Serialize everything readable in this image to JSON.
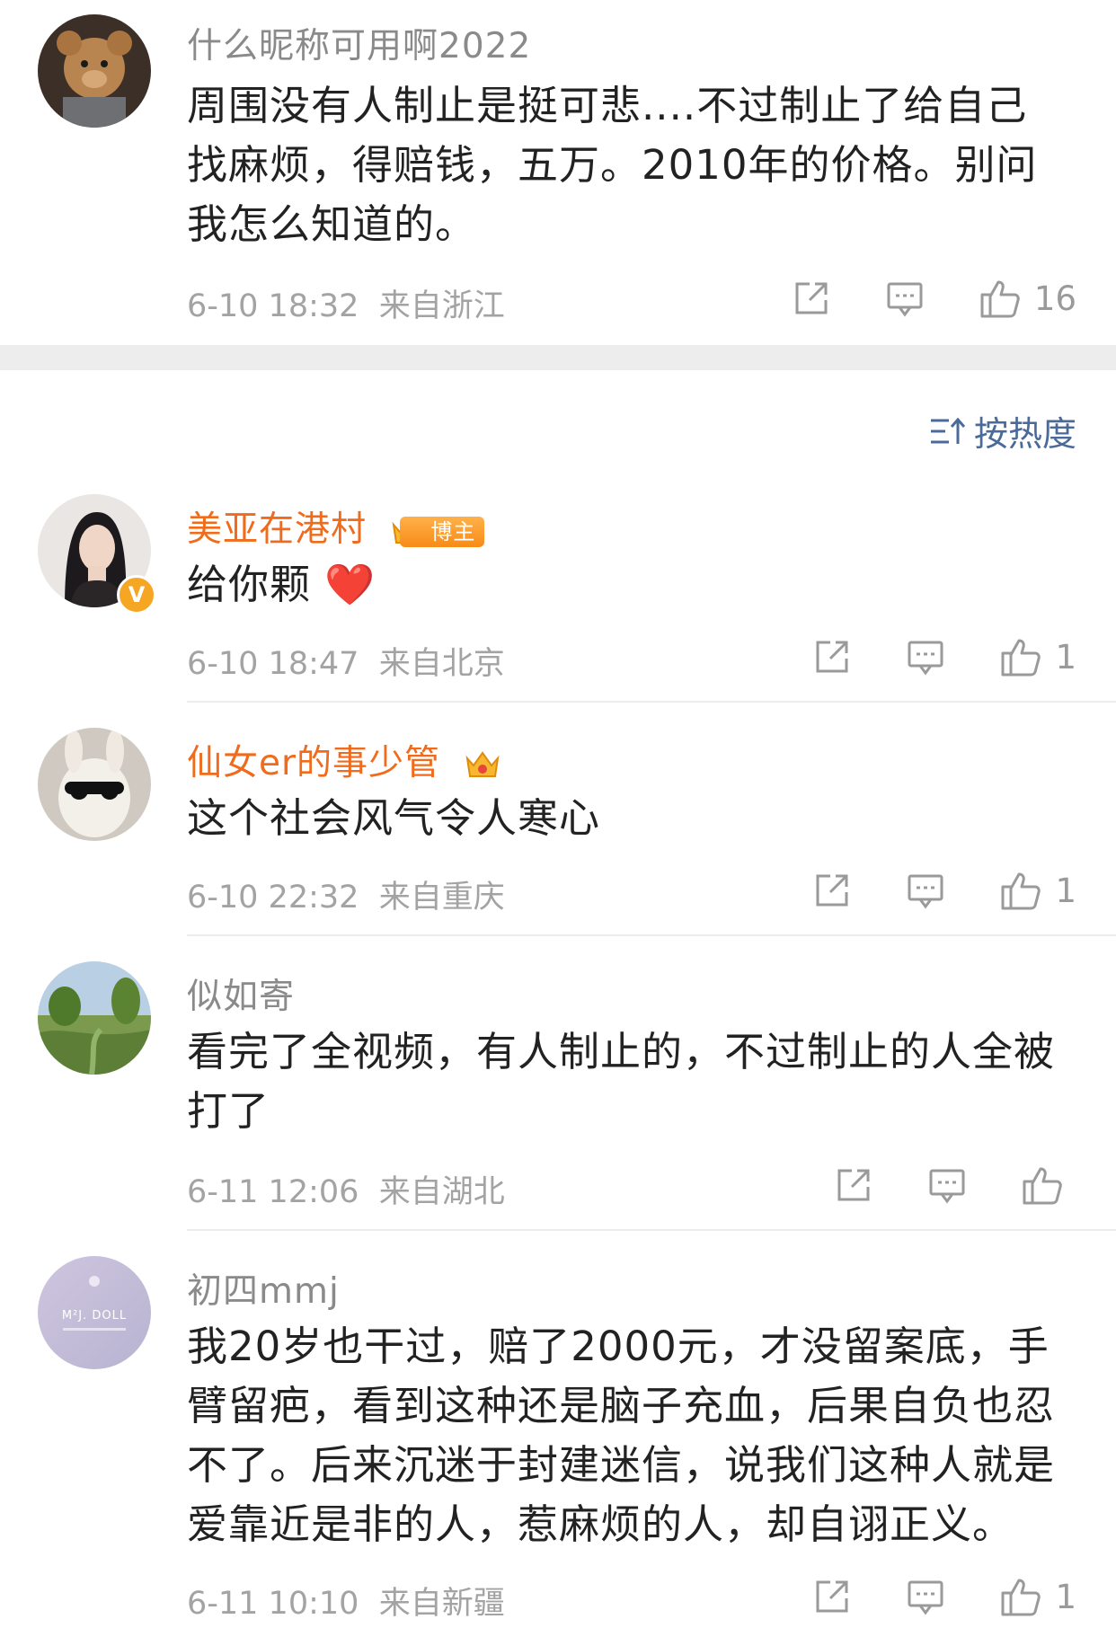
{
  "comments": [
    {
      "username": "什么昵称可用啊2022",
      "text": "周围没有人制止是挺可悲....不过制止了给自己找麻烦，得赔钱，五万。2010年的价格。别问我怎么知道的。",
      "time": "6-10 18:32",
      "location": "来自浙江",
      "likes": "16"
    },
    {
      "username": "美亚在港村",
      "badge": "博主",
      "text": "给你颗 ❤️",
      "time": "6-10 18:47",
      "location": "来自北京",
      "likes": "1"
    },
    {
      "username": "仙女er的事少管",
      "text": "这个社会风气令人寒心",
      "time": "6-10 22:32",
      "location": "来自重庆",
      "likes": "1"
    },
    {
      "username": "似如寄",
      "text": "看完了全视频，有人制止的，不过制止的人全被打了",
      "time": "6-11 12:06",
      "location": "来自湖北",
      "likes": ""
    },
    {
      "username": "初四mmj",
      "avatar_text": "M²J. DOLL",
      "text": "我20岁也干过，赔了2000元，才没留案底，手臂留疤，看到这种还是脑子充血，后果自负也忍不了。后来沉迷于封建迷信，说我们这种人就是爱靠近是非的人，惹麻烦的人，却自诩正义。",
      "time": "6-11 10:10",
      "location": "来自新疆",
      "likes": "1"
    }
  ],
  "sort": {
    "label": "按热度"
  },
  "colors": {
    "name_orange": "#f06b1b",
    "link_blue": "#4a6b9a"
  }
}
